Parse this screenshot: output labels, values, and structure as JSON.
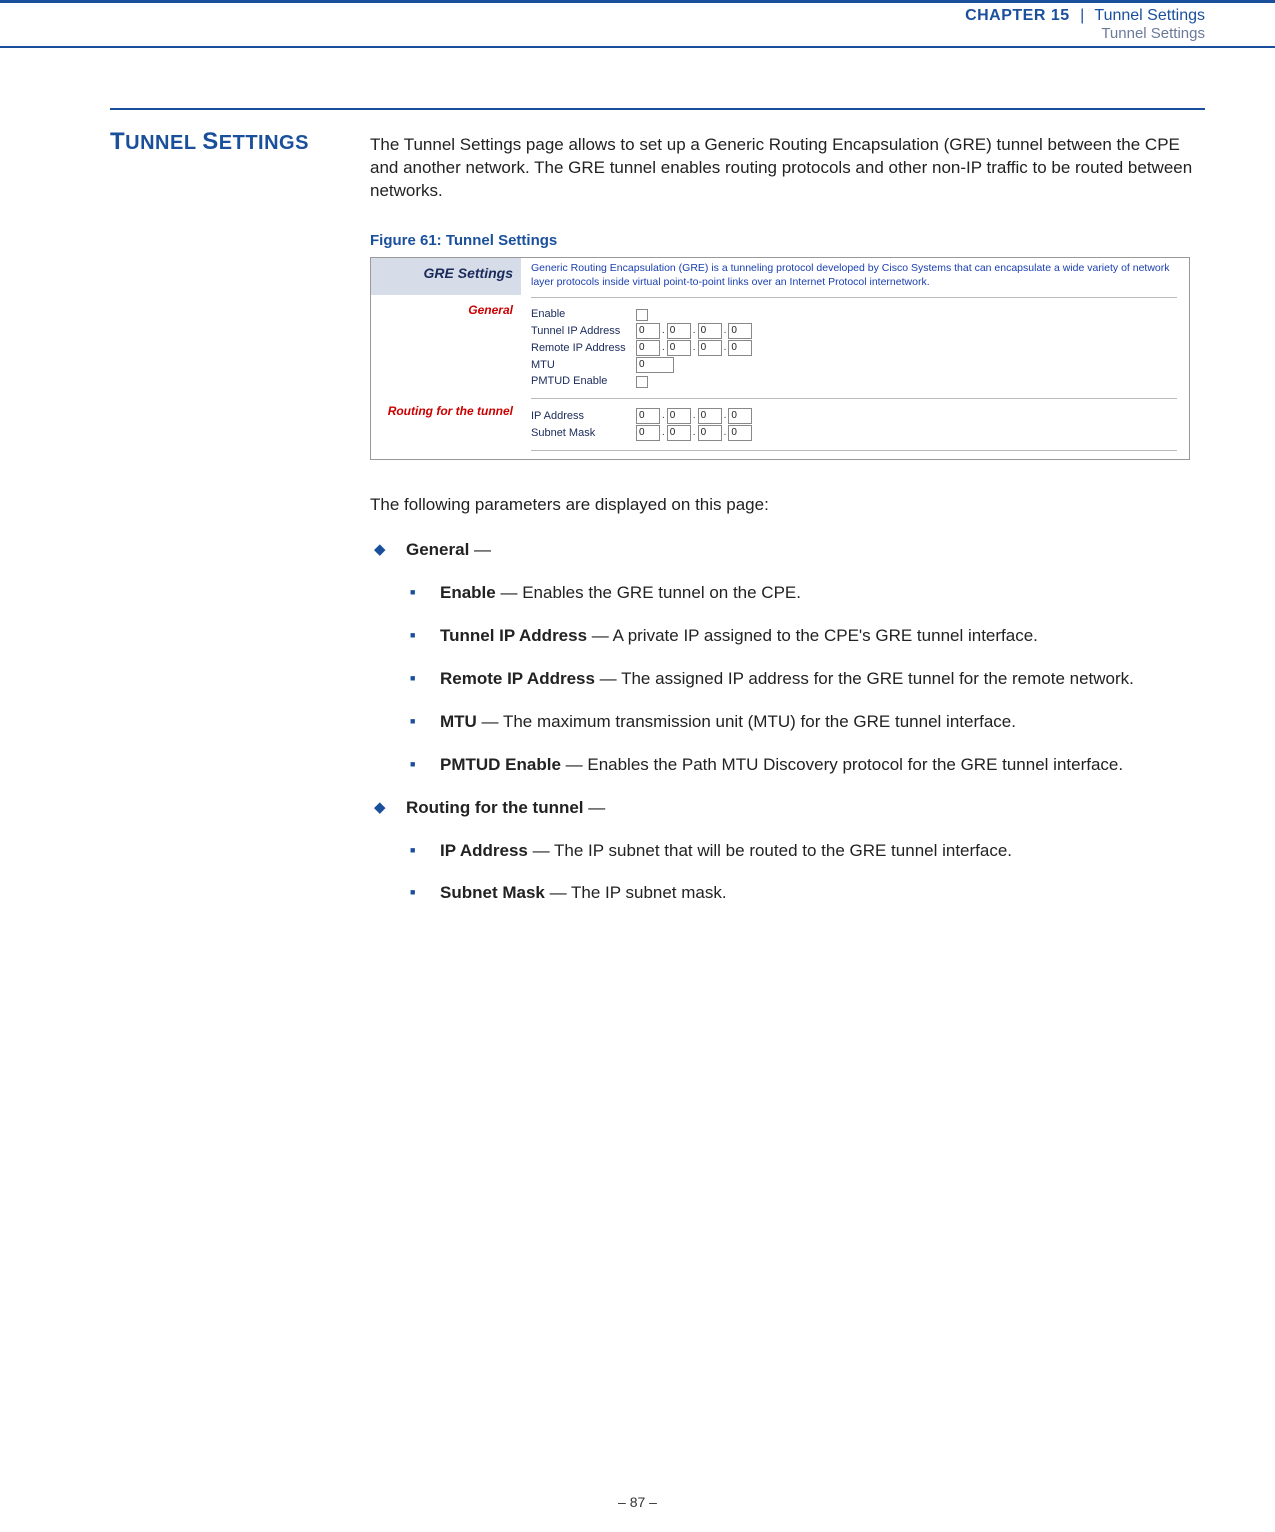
{
  "header": {
    "chapter": "CHAPTER 15",
    "sep": "|",
    "title1": "Tunnel Settings",
    "title2": "Tunnel Settings"
  },
  "section_title": {
    "w1a": "T",
    "w1b": "UNNEL",
    "w2a": "S",
    "w2b": "ETTINGS"
  },
  "intro": "The Tunnel Settings page allows to set up a Generic Routing Encapsulation (GRE) tunnel between the CPE and another network. The GRE tunnel enables routing protocols and other non-IP traffic to be routed between networks.",
  "figcap": "Figure 61:  Tunnel Settings",
  "figure": {
    "hdr_left": "GRE Settings",
    "hdr_right": "Generic Routing Encapsulation (GRE) is a tunneling protocol developed by Cisco Systems that can encapsulate a wide variety of network layer protocols inside virtual point-to-point links over an Internet Protocol internetwork.",
    "general_label": "General",
    "routing_label": "Routing for the tunnel",
    "fields": {
      "enable": "Enable",
      "tunnel_ip": "Tunnel IP Address",
      "remote_ip": "Remote IP Address",
      "mtu": "MTU",
      "pmtud": "PMTUD Enable",
      "ip_addr": "IP Address",
      "subnet": "Subnet Mask"
    },
    "values": {
      "tunnel_ip": [
        "0",
        "0",
        "0",
        "0"
      ],
      "remote_ip": [
        "0",
        "0",
        "0",
        "0"
      ],
      "mtu": "0",
      "ip_addr": [
        "0",
        "0",
        "0",
        "0"
      ],
      "subnet": [
        "0",
        "0",
        "0",
        "0"
      ]
    }
  },
  "lead": "The following parameters are displayed on this page:",
  "bullets": {
    "general": {
      "title": "General",
      "dash": " — "
    },
    "enable": {
      "title": "Enable",
      "text": " — Enables the GRE tunnel on the CPE."
    },
    "tunnel_ip": {
      "title": "Tunnel IP Address",
      "text": " — A private IP assigned to the CPE's GRE tunnel interface."
    },
    "remote_ip": {
      "title": "Remote IP Address",
      "text": " — The assigned IP address for the GRE tunnel for the remote network."
    },
    "mtu": {
      "title": "MTU",
      "text": " — The maximum transmission unit (MTU) for the GRE tunnel interface."
    },
    "pmtud": {
      "title": "PMTUD Enable",
      "text": " — Enables the Path MTU Discovery protocol for the GRE tunnel interface."
    },
    "routing": {
      "title": "Routing for the tunnel",
      "dash": " — "
    },
    "ip_addr": {
      "title": "IP Address",
      "text": " — The IP subnet that will be routed to the GRE tunnel interface."
    },
    "subnet": {
      "title": "Subnet Mask",
      "text": " — The IP subnet mask."
    }
  },
  "footer": "–  87  –"
}
